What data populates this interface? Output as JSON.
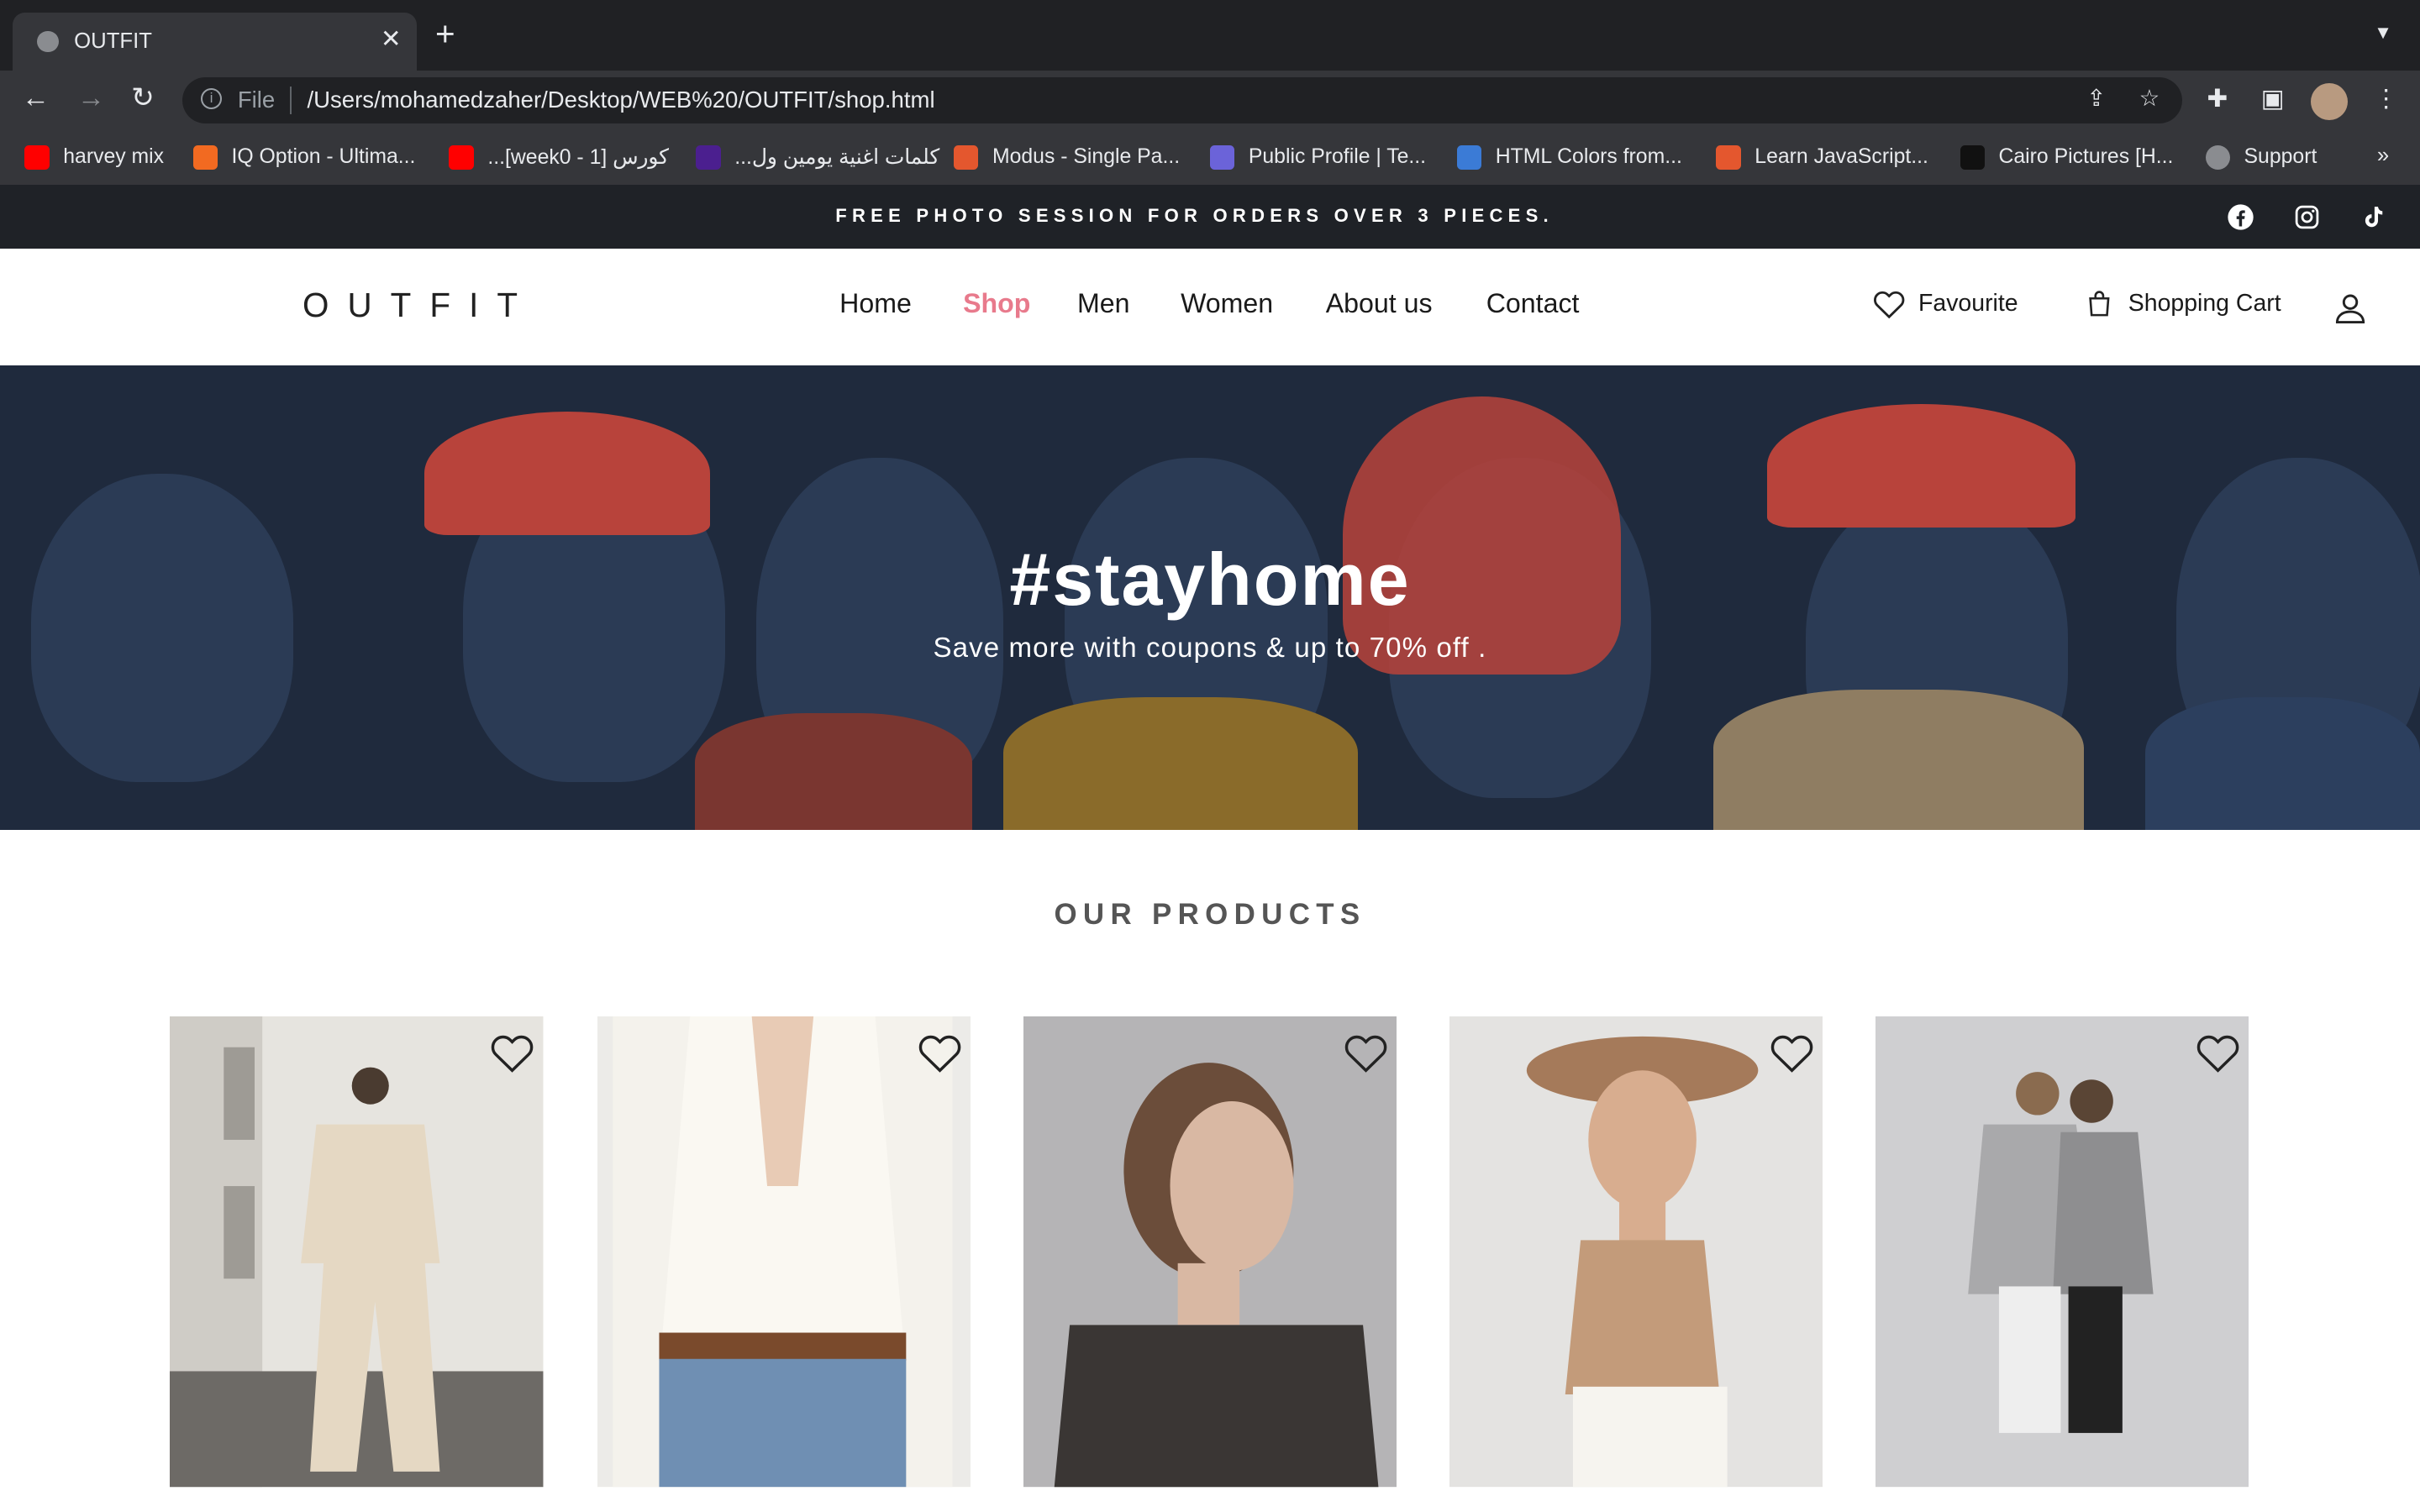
{
  "browser": {
    "tab_title": "OUTFIT",
    "url_scheme": "File",
    "url": "/Users/mohamedzaher/Desktop/WEB%20/OUTFIT/shop.html",
    "bookmarks": [
      {
        "label": "harvey mix",
        "color": "#ff0000"
      },
      {
        "label": "IQ Option - Ultima...",
        "color": "#f26a21"
      },
      {
        "label": "كورس [1 - week0]...",
        "color": "#ff0000"
      },
      {
        "label": "كلمات اغنية يومين ول...",
        "color": "#4b1f8f"
      },
      {
        "label": "Modus - Single Pa...",
        "color": "#e4572e"
      },
      {
        "label": "Public Profile | Te...",
        "color": "#6b63d9"
      },
      {
        "label": "HTML Colors from...",
        "color": "#3b7bd6"
      },
      {
        "label": "Learn JavaScript...",
        "color": "#e4572e"
      },
      {
        "label": "Cairo Pictures [H...",
        "color": "#111111"
      },
      {
        "label": "Support",
        "color": "#8a8c90"
      }
    ]
  },
  "promo": {
    "text": "FREE PHOTO SESSION FOR ORDERS OVER 3 PIECES.",
    "social_icons": [
      "facebook-icon",
      "instagram-icon",
      "tiktok-icon"
    ]
  },
  "header": {
    "logo": "OUTFIT",
    "nav": [
      {
        "label": "Home",
        "active": false
      },
      {
        "label": "Shop",
        "active": true
      },
      {
        "label": "Men",
        "active": false
      },
      {
        "label": "Women",
        "active": false
      },
      {
        "label": "About us",
        "active": false
      },
      {
        "label": "Contact",
        "active": false
      }
    ],
    "favourite_label": "Favourite",
    "cart_label": "Shopping Cart",
    "accent_color": "#e87a8c"
  },
  "hero": {
    "title": "#stayhome",
    "subtitle": "Save more with coupons & up to 70% off ."
  },
  "products": {
    "title": "OUR PRODUCTS",
    "items": [
      {
        "image": "woman-beige-sweatsuit-photo"
      },
      {
        "image": "woman-white-silk-shirt-photo"
      },
      {
        "image": "woman-sheer-black-top-photo"
      },
      {
        "image": "woman-hat-tan-top-photo"
      },
      {
        "image": "two-women-grey-cardigans-photo"
      }
    ]
  }
}
